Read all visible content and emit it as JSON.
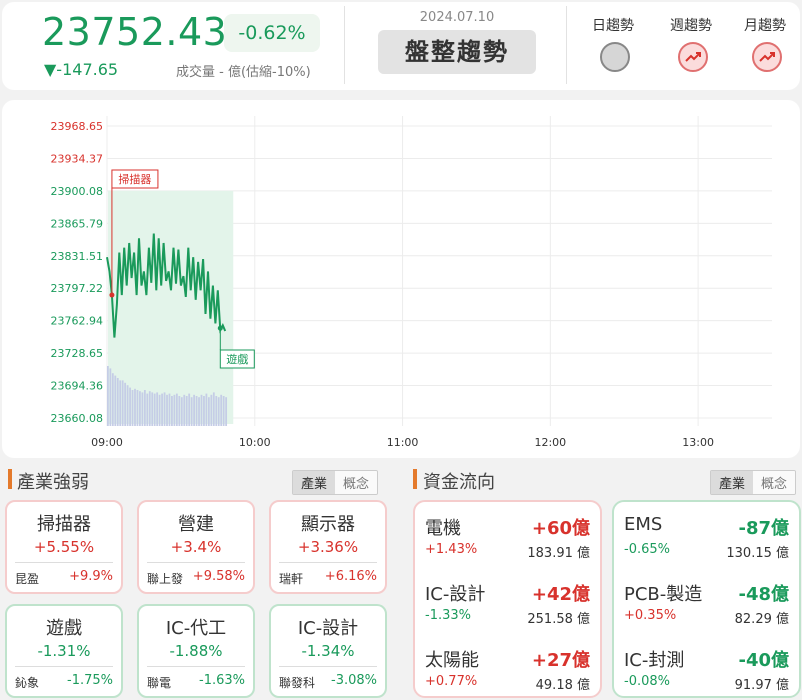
{
  "header": {
    "index_value": "23752.43",
    "change_pct": "-0.62%",
    "change_pts": "▼-147.65",
    "volume_label": "成交量 - 億(估縮-10%)",
    "date": "2024.07.10",
    "trend_tag": "盤整趨勢",
    "trends": [
      {
        "label": "日趨勢",
        "state": "neutral"
      },
      {
        "label": "週趨勢",
        "state": "up"
      },
      {
        "label": "月趨勢",
        "state": "up"
      }
    ]
  },
  "chart": {
    "y_ticks": [
      "23968.65",
      "23934.37",
      "23900.08",
      "23865.79",
      "23831.51",
      "23797.22",
      "23762.94",
      "23728.65",
      "23694.36",
      "23660.08"
    ],
    "x_ticks": [
      "09:00",
      "10:00",
      "11:00",
      "12:00",
      "13:00"
    ],
    "marker_top": "掃描器",
    "marker_bottom": "遊戲"
  },
  "chart_data": {
    "type": "line",
    "title": "",
    "xlabel": "",
    "ylabel": "",
    "ylim": [
      23660.08,
      23968.65
    ],
    "x_range": [
      "09:00",
      "13:30"
    ],
    "series": [
      {
        "points": [
          [
            "09:00",
            23830
          ],
          [
            "09:01",
            23815
          ],
          [
            "09:02",
            23790
          ],
          [
            "09:03",
            23745
          ],
          [
            "09:04",
            23780
          ],
          [
            "09:05",
            23835
          ],
          [
            "09:06",
            23790
          ],
          [
            "09:07",
            23840
          ],
          [
            "09:08",
            23800
          ],
          [
            "09:09",
            23845
          ],
          [
            "09:10",
            23808
          ],
          [
            "09:11",
            23835
          ],
          [
            "09:12",
            23790
          ],
          [
            "09:13",
            23850
          ],
          [
            "09:14",
            23800
          ],
          [
            "09:15",
            23815
          ],
          [
            "09:16",
            23790
          ],
          [
            "09:17",
            23840
          ],
          [
            "09:18",
            23803
          ],
          [
            "09:19",
            23855
          ],
          [
            "09:20",
            23795
          ],
          [
            "09:21",
            23850
          ],
          [
            "09:22",
            23800
          ],
          [
            "09:23",
            23845
          ],
          [
            "09:24",
            23805
          ],
          [
            "09:25",
            23815
          ],
          [
            "09:26",
            23795
          ],
          [
            "09:27",
            23840
          ],
          [
            "09:28",
            23802
          ],
          [
            "09:29",
            23838
          ],
          [
            "09:30",
            23800
          ],
          [
            "09:31",
            23810
          ],
          [
            "09:32",
            23788
          ],
          [
            "09:33",
            23840
          ],
          [
            "09:34",
            23795
          ],
          [
            "09:35",
            23830
          ],
          [
            "09:36",
            23785
          ],
          [
            "09:37",
            23825
          ],
          [
            "09:38",
            23795
          ],
          [
            "09:39",
            23828
          ],
          [
            "09:40",
            23770
          ],
          [
            "09:41",
            23815
          ],
          [
            "09:42",
            23765
          ],
          [
            "09:43",
            23800
          ],
          [
            "09:44",
            23760
          ],
          [
            "09:45",
            23795
          ],
          [
            "09:46",
            23753
          ],
          [
            "09:47",
            23758
          ],
          [
            "09:48",
            23752
          ]
        ]
      }
    ],
    "volume": [
      50,
      48,
      44,
      42,
      40,
      38,
      38,
      36,
      34,
      32,
      30,
      31,
      30,
      29,
      28,
      30,
      27,
      29,
      28,
      27,
      28,
      26,
      27,
      28,
      26,
      27,
      25,
      26,
      27,
      25,
      24,
      26,
      25,
      27,
      24,
      26,
      25,
      24,
      26,
      25,
      27,
      24,
      26,
      28,
      25,
      24,
      26,
      25,
      24
    ],
    "markers": [
      {
        "label": "掃描器",
        "x": "09:02",
        "y": 23790
      },
      {
        "label": "遊戲",
        "x": "09:46",
        "y": 23755
      }
    ]
  },
  "industry": {
    "title": "產業強弱",
    "tabs": [
      "產業",
      "概念"
    ],
    "cards": [
      {
        "name": "掃描器",
        "pct": "+5.55%",
        "stock": "昆盈",
        "stock_pct": "+9.9%",
        "dir": "up"
      },
      {
        "name": "營建",
        "pct": "+3.4%",
        "stock": "聯上發",
        "stock_pct": "+9.58%",
        "dir": "up"
      },
      {
        "name": "顯示器",
        "pct": "+3.36%",
        "stock": "瑞軒",
        "stock_pct": "+6.16%",
        "dir": "up"
      },
      {
        "name": "遊戲",
        "pct": "-1.31%",
        "stock": "鈊象",
        "stock_pct": "-1.75%",
        "dir": "dn"
      },
      {
        "name": "IC-代工",
        "pct": "-1.88%",
        "stock": "聯電",
        "stock_pct": "-1.63%",
        "dir": "dn"
      },
      {
        "name": "IC-設計",
        "pct": "-1.34%",
        "stock": "聯發科",
        "stock_pct": "-3.08%",
        "dir": "dn"
      }
    ]
  },
  "fund": {
    "title": "資金流向",
    "tabs": [
      "產業",
      "概念"
    ],
    "inflow": [
      {
        "name": "電機",
        "amount": "+60億",
        "pct": "+1.43%",
        "vol": "183.91 億"
      },
      {
        "name": "IC-設計",
        "amount": "+42億",
        "pct": "-1.33%",
        "vol": "251.58 億"
      },
      {
        "name": "太陽能",
        "amount": "+27億",
        "pct": "+0.77%",
        "vol": "49.18 億"
      }
    ],
    "outflow": [
      {
        "name": "EMS",
        "amount": "-87億",
        "pct": "-0.65%",
        "vol": "130.15 億"
      },
      {
        "name": "PCB-製造",
        "amount": "-48億",
        "pct": "+0.35%",
        "vol": "82.29 億"
      },
      {
        "name": "IC-封測",
        "amount": "-40億",
        "pct": "-0.08%",
        "vol": "91.97 億"
      }
    ]
  },
  "colors": {
    "up": "#d8322c",
    "down": "#1a9a5b",
    "accent": "#e47a2c",
    "area": "#e3f4ea",
    "volume": "#c5cde6"
  }
}
